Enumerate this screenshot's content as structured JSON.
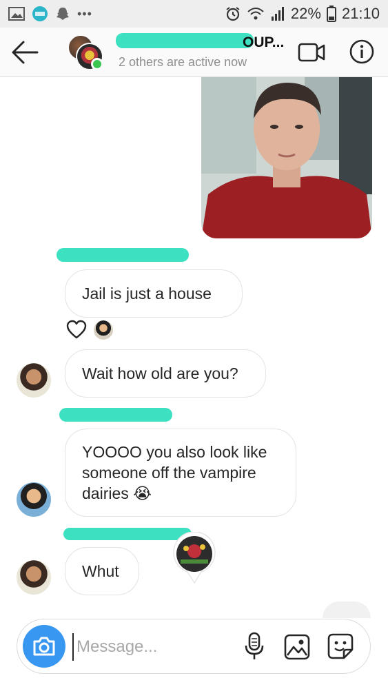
{
  "status_bar": {
    "battery": "22%",
    "time": "21:10",
    "overflow": "•••"
  },
  "header": {
    "title_suffix": "OUP...",
    "subtitle": "2 others are active now"
  },
  "messages": [
    {
      "text": "Jail is just a house"
    },
    {
      "text": "Wait how old are you?"
    },
    {
      "text": "YOOOO you also look like someone off the vampire dairies 😭"
    },
    {
      "text": "Whut"
    }
  ],
  "composer": {
    "placeholder": "Message..."
  },
  "colors": {
    "accent": "#3897f0",
    "online": "#3bc651",
    "redaction": "#3de0c0",
    "bubble_border": "#e3e3e3"
  },
  "icons": [
    "back-arrow-icon",
    "video-call-icon",
    "info-icon",
    "heart-icon",
    "camera-icon",
    "mic-icon",
    "gallery-icon",
    "sticker-icon"
  ]
}
